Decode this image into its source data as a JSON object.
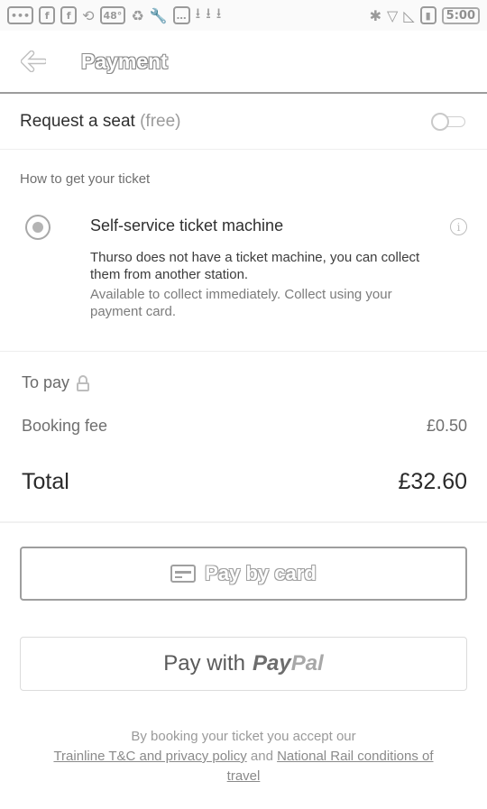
{
  "status_bar": {
    "left_icons": [
      "messages-icon",
      "facebook-icon",
      "facebook-icon",
      "share-icon",
      "weather-icon",
      "recycle-icon",
      "wrench-icon",
      "chat-icon",
      "download-icon",
      "download-icon",
      "download-icon"
    ],
    "fb1": "f",
    "fb2": "f",
    "temperature": "48°",
    "time": "5:00"
  },
  "header": {
    "title": "Payment"
  },
  "seat": {
    "label": "Request a seat",
    "suffix": "(free)",
    "toggle_on": false
  },
  "delivery": {
    "heading": "How to get your ticket",
    "option_title": "Self-service ticket machine",
    "option_desc": "Thurso does not have a ticket machine, you can collect them from another station.",
    "option_note": "Available to collect immediately. Collect using your payment card."
  },
  "price": {
    "to_pay_label": "To pay",
    "fee_label": "Booking fee",
    "fee_value": "£0.50",
    "total_label": "Total",
    "total_value": "£32.60"
  },
  "buttons": {
    "card_label": "Pay by card",
    "paypal_prefix": "Pay with",
    "paypal_brand_pay": "Pay",
    "paypal_brand_pal": "Pal"
  },
  "legal": {
    "intro": "By booking your ticket you accept our",
    "link1": "Trainline T&C and privacy policy",
    "and": "and",
    "link2": "National Rail conditions of travel"
  },
  "colors": {
    "background": "#ffffff",
    "text_primary": "#2f2f2f",
    "text_muted": "#9a9a9a"
  }
}
